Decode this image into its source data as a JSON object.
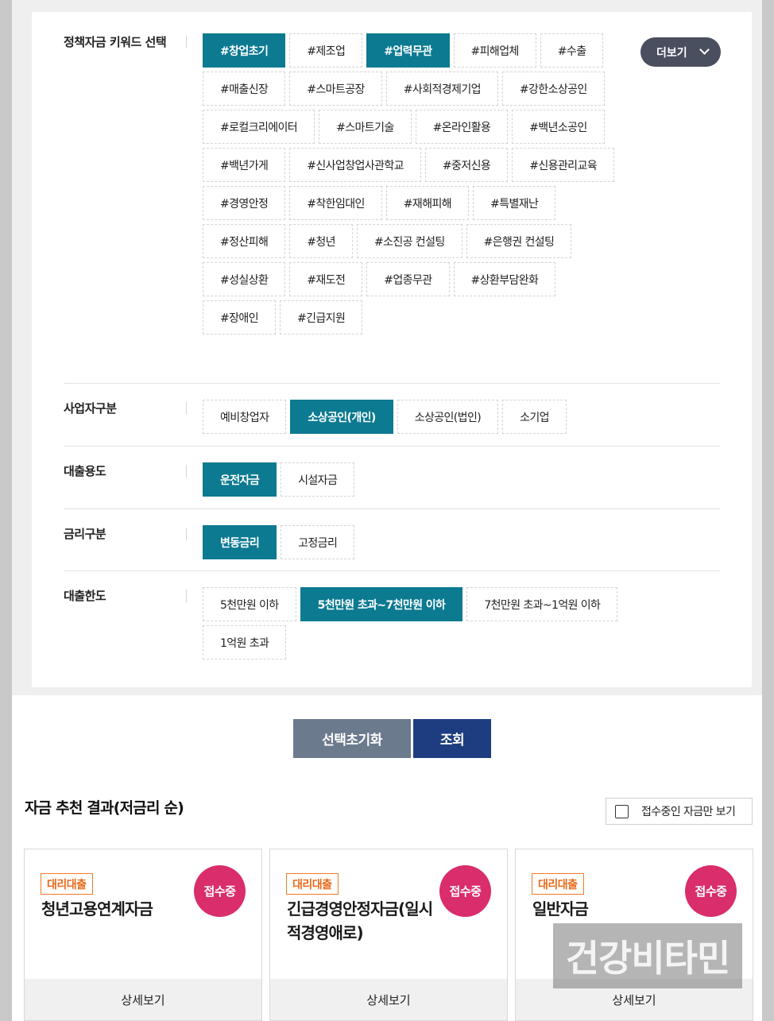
{
  "filters": {
    "keywords": {
      "label": "정책자금 키워드 선택",
      "more_label": "더보기",
      "chips": [
        {
          "text": "#창업초기",
          "active": true
        },
        {
          "text": "#제조업",
          "active": false
        },
        {
          "text": "#업력무관",
          "active": true
        },
        {
          "text": "#피해업체",
          "active": false
        },
        {
          "text": "#수출",
          "active": false
        },
        {
          "text": "#매출신장",
          "active": false
        },
        {
          "text": "#스마트공장",
          "active": false
        },
        {
          "text": "#사회적경제기업",
          "active": false
        },
        {
          "text": "#강한소상공인",
          "active": false
        },
        {
          "text": "#로컬크리에이터",
          "active": false
        },
        {
          "text": "#스마트기술",
          "active": false
        },
        {
          "text": "#온라인활용",
          "active": false
        },
        {
          "text": "#백년소공인",
          "active": false
        },
        {
          "text": "#백년가게",
          "active": false
        },
        {
          "text": "#신사업창업사관학교",
          "active": false
        },
        {
          "text": "#중저신용",
          "active": false
        },
        {
          "text": "#신용관리교육",
          "active": false
        },
        {
          "text": "#경영안정",
          "active": false
        },
        {
          "text": "#착한임대인",
          "active": false
        },
        {
          "text": "#재해피해",
          "active": false
        },
        {
          "text": "#특별재난",
          "active": false
        },
        {
          "text": "#정산피해",
          "active": false
        },
        {
          "text": "#청년",
          "active": false
        },
        {
          "text": "#소진공 컨설팅",
          "active": false
        },
        {
          "text": "#은행권 컨설팅",
          "active": false
        },
        {
          "text": "#성실상환",
          "active": false
        },
        {
          "text": "#재도전",
          "active": false
        },
        {
          "text": "#업종무관",
          "active": false
        },
        {
          "text": "#상환부담완화",
          "active": false
        },
        {
          "text": "#장애인",
          "active": false
        },
        {
          "text": "#긴급지원",
          "active": false
        }
      ]
    },
    "business_type": {
      "label": "사업자구분",
      "chips": [
        {
          "text": "예비창업자",
          "active": false
        },
        {
          "text": "소상공인(개인)",
          "active": true
        },
        {
          "text": "소상공인(법인)",
          "active": false
        },
        {
          "text": "소기업",
          "active": false
        }
      ]
    },
    "loan_purpose": {
      "label": "대출용도",
      "chips": [
        {
          "text": "운전자금",
          "active": true
        },
        {
          "text": "시설자금",
          "active": false
        }
      ]
    },
    "interest_type": {
      "label": "금리구분",
      "chips": [
        {
          "text": "변동금리",
          "active": true
        },
        {
          "text": "고정금리",
          "active": false
        }
      ]
    },
    "loan_limit": {
      "label": "대출한도",
      "chips": [
        {
          "text": "5천만원 이하",
          "active": false
        },
        {
          "text": "5천만원 초과~7천만원 이하",
          "active": true
        },
        {
          "text": "7천만원 초과~1억원 이하",
          "active": false
        },
        {
          "text": "1억원 초과",
          "active": false
        }
      ]
    }
  },
  "actions": {
    "reset_label": "선택초기화",
    "search_label": "조회"
  },
  "results": {
    "title": "자금 추천 결과(저금리 순)",
    "open_only_label": "접수중인 자금만 보기",
    "open_only_checked": false,
    "cards": [
      {
        "badge": "대리대출",
        "name": "청년고용연계자금",
        "status": "접수중",
        "detail": "상세보기"
      },
      {
        "badge": "대리대출",
        "name": "긴급경영안정자금(일시적경영애로)",
        "status": "접수중",
        "detail": "상세보기"
      },
      {
        "badge": "대리대출",
        "name": "일반자금",
        "status": "접수중",
        "detail": "상세보기"
      }
    ]
  },
  "watermark": "건강비타민",
  "colors": {
    "chip_active": "#0c7a91",
    "more_button": "#4a4f60",
    "reset_button": "#6c7a8e",
    "search_button": "#1e3d80",
    "badge": "#ef7a2b",
    "status": "#d92d6c"
  }
}
